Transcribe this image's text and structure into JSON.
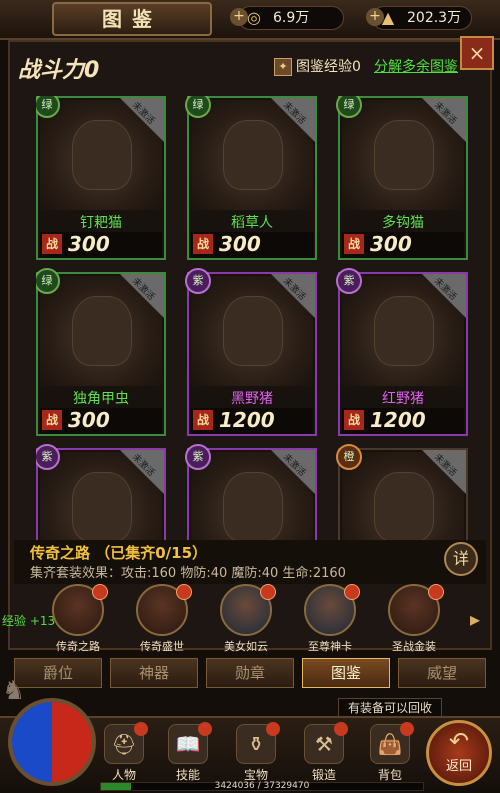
{
  "header": {
    "title": "图鉴",
    "resource1": "6.9万",
    "resource2": "202.3万",
    "plus_label": "+"
  },
  "panel": {
    "close_label": "×",
    "power_label": "战斗力0",
    "exp_label": "图鉴经验0",
    "decompose_label": "分解多余图鉴"
  },
  "cards": [
    {
      "grade": "绿",
      "name": "钉耙猫",
      "power": "300",
      "status": "未激活"
    },
    {
      "grade": "绿",
      "name": "稻草人",
      "power": "300",
      "status": "未激活"
    },
    {
      "grade": "绿",
      "name": "多钩猫",
      "power": "300",
      "status": "未激活"
    },
    {
      "grade": "绿",
      "name": "独角甲虫",
      "power": "300",
      "status": "未激活"
    },
    {
      "grade": "紫",
      "name": "黑野猪",
      "power": "1200",
      "status": "未激活"
    },
    {
      "grade": "紫",
      "name": "红野猪",
      "power": "1200",
      "status": "未激活"
    },
    {
      "grade": "紫",
      "name": "",
      "power": "",
      "status": "未激活"
    },
    {
      "grade": "紫",
      "name": "",
      "power": "",
      "status": "未激活"
    },
    {
      "grade": "橙",
      "name": "",
      "power": "",
      "status": "未激活"
    }
  ],
  "card_power_tag": "战",
  "set": {
    "title": "传奇之路",
    "count": "（已集齐0/15）",
    "effect": "集齐套装效果：攻击:160  物防:40  魔防:40  生命:2160",
    "detail_label": "详",
    "exp_gain": "经验 +13",
    "items": [
      {
        "label": "传奇之路"
      },
      {
        "label": "传奇盛世"
      },
      {
        "label": "美女如云"
      },
      {
        "label": "至尊神卡"
      },
      {
        "label": "圣战金装"
      }
    ],
    "arrow": "▸"
  },
  "tabs": [
    {
      "label": "爵位"
    },
    {
      "label": "神器"
    },
    {
      "label": "勋章"
    },
    {
      "label": "图鉴"
    },
    {
      "label": "威望"
    }
  ],
  "notice": "有装备可以回收",
  "menu": [
    {
      "label": "人物",
      "icon": "helmet-icon",
      "glyph": "⛑"
    },
    {
      "label": "技能",
      "icon": "book-icon",
      "glyph": "📖"
    },
    {
      "label": "宝物",
      "icon": "treasure-icon",
      "glyph": "⚱"
    },
    {
      "label": "锻造",
      "icon": "anvil-icon",
      "glyph": "⚒"
    },
    {
      "label": "背包",
      "icon": "bag-icon",
      "glyph": "👜"
    }
  ],
  "return_label": "返回",
  "xp_text": "3424036 / 37329470",
  "xp_fraction": 0.092
}
